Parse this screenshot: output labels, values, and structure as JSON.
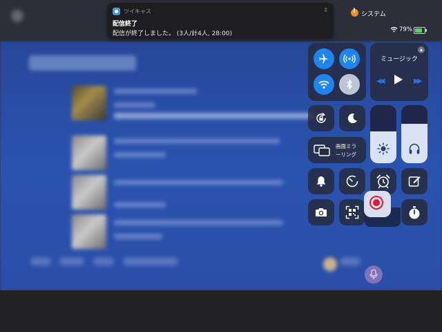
{
  "notification": {
    "app_name": "ツイキャス",
    "title": "配信終了",
    "body": "配信が終了しました。 (3人/計4人, 28:00)"
  },
  "status_bar": {
    "system_label": "システム",
    "battery_percent": "79%",
    "battery_level": 0.79,
    "charging": true
  },
  "control_center": {
    "connectivity": {
      "airplane_mode": true,
      "cellular": true,
      "wifi": true,
      "bluetooth": false
    },
    "music": {
      "title": "ミュージック"
    },
    "screen_mirroring": {
      "label": "画面ミラーリング",
      "label_line1": "画面ミラ",
      "label_line2": "ーリング"
    },
    "brightness_level": 0.55,
    "volume_level": 0.68,
    "recording_active": true,
    "icons": [
      "airplane-icon",
      "cellular-icon",
      "wifi-icon",
      "bluetooth-icon",
      "rotation-lock-icon",
      "moon-icon",
      "mirroring-icon",
      "brightness-icon",
      "headphones-icon",
      "bell-icon",
      "timer-icon",
      "alarm-icon",
      "note-icon",
      "camera-icon",
      "qr-scan-icon",
      "record-icon",
      "stopwatch-icon"
    ]
  },
  "colors": {
    "accent_blue": "#1d84f0",
    "record_red": "#e8152e",
    "battery_green": "#4cd964",
    "background_blue": "#2a53b0"
  }
}
